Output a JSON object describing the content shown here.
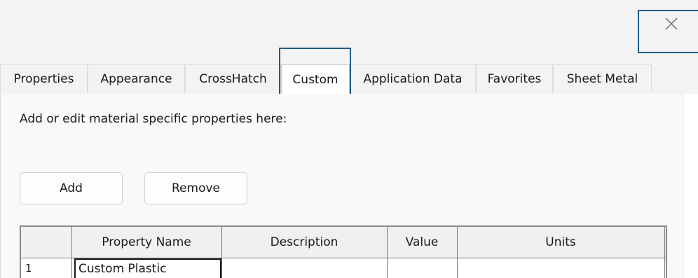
{
  "window": {
    "close_icon": "close-icon"
  },
  "tabs": [
    {
      "label": "Properties",
      "active": false
    },
    {
      "label": "Appearance",
      "active": false
    },
    {
      "label": "CrossHatch",
      "active": false
    },
    {
      "label": "Custom",
      "active": true
    },
    {
      "label": "Application Data",
      "active": false
    },
    {
      "label": "Favorites",
      "active": false
    },
    {
      "label": "Sheet Metal",
      "active": false
    }
  ],
  "custom_panel": {
    "instructions": "Add or edit material specific properties here:",
    "add_label": "Add",
    "remove_label": "Remove",
    "columns": [
      "Property Name",
      "Description",
      "Value",
      "Units"
    ],
    "rows": [
      {
        "number": "1",
        "property_name": "Custom Plastic",
        "description": "",
        "value": "",
        "units": ""
      }
    ]
  },
  "colors": {
    "highlight": "#1f5c85",
    "chrome": "#f3f3f3",
    "panel": "#f9f9f9"
  }
}
